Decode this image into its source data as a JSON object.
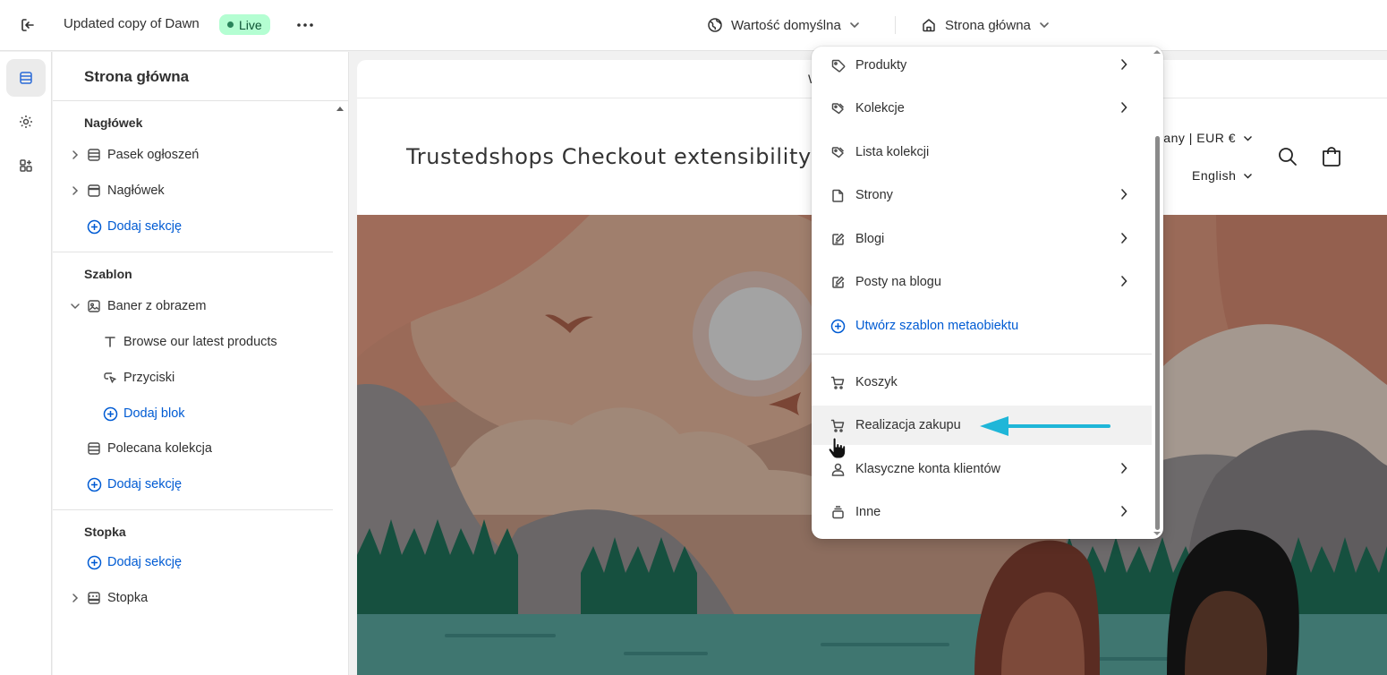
{
  "topbar": {
    "theme_title": "Updated copy of Dawn",
    "live_badge": "Live",
    "language_selector": "Wartość domyślna",
    "page_selector": "Strona główna"
  },
  "sidebar": {
    "title": "Strona główna",
    "header_section": {
      "label": "Nagłówek",
      "items": [
        "Pasek ogłoszeń",
        "Nagłówek"
      ],
      "add_section": "Dodaj sekcję"
    },
    "template_section": {
      "label": "Szablon",
      "banner": "Baner z obrazem",
      "banner_blocks": [
        "Browse our latest products",
        "Przyciski"
      ],
      "add_block": "Dodaj blok",
      "featured_collection": "Polecana kolekcja",
      "add_section": "Dodaj sekcję"
    },
    "footer_section": {
      "label": "Stopka",
      "add_section": "Dodaj sekcję",
      "items": [
        "Stopka"
      ]
    }
  },
  "preview": {
    "announcement": "W",
    "store_name": "Trustedshops Checkout extensibility te",
    "country_currency": "nany | EUR €",
    "language": "English"
  },
  "dropdown": {
    "items": [
      {
        "label": "Produkty",
        "icon": "tag-icon",
        "has_submenu": true
      },
      {
        "label": "Kolekcje",
        "icon": "tags-icon",
        "has_submenu": true
      },
      {
        "label": "Lista kolekcji",
        "icon": "tags-icon",
        "has_submenu": false
      },
      {
        "label": "Strony",
        "icon": "page-icon",
        "has_submenu": true
      },
      {
        "label": "Blogi",
        "icon": "edit-icon",
        "has_submenu": true
      },
      {
        "label": "Posty na blogu",
        "icon": "edit-icon",
        "has_submenu": true
      },
      {
        "label": "Utwórz szablon metaobiektu",
        "icon": "plus-circle-icon",
        "has_submenu": false
      },
      {
        "label": "Koszyk",
        "icon": "cart-icon",
        "has_submenu": false
      },
      {
        "label": "Realizacja zakupu",
        "icon": "cart-icon",
        "has_submenu": false
      },
      {
        "label": "Klasyczne konta klientów",
        "icon": "person-icon",
        "has_submenu": true
      },
      {
        "label": "Inne",
        "icon": "stack-icon",
        "has_submenu": true
      }
    ]
  },
  "colors": {
    "link_blue": "#005bd3",
    "live_bg": "#b4fed2",
    "callout_arrow": "#1fb6d8"
  }
}
